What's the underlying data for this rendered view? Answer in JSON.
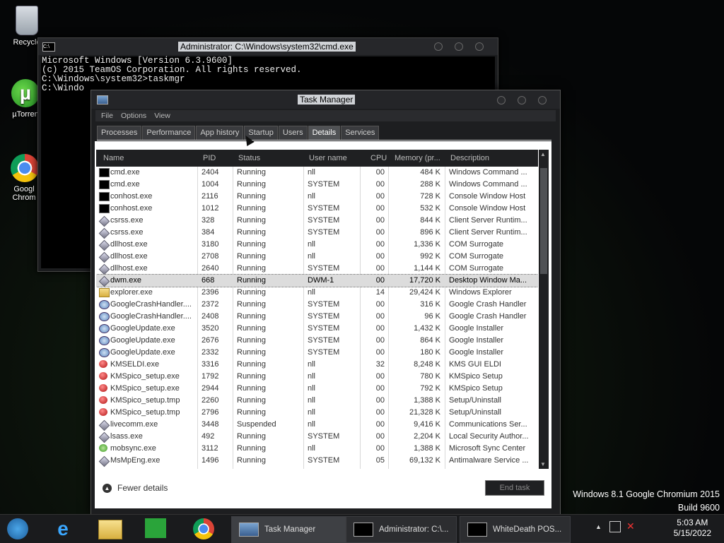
{
  "desktop": {
    "icons": [
      {
        "label": "Recycle"
      },
      {
        "label": "µTorren"
      },
      {
        "label": "Googl Chrom"
      }
    ]
  },
  "cmd_window": {
    "title": "Administrator: C:\\Windows\\system32\\cmd.exe",
    "lines": [
      "Microsoft Windows [Version 6.3.9600]",
      "(c) 2015 TeamOS Corporation. All rights reserved.",
      "",
      "C:\\Windows\\system32>taskmgr",
      "",
      "C:\\Windo"
    ]
  },
  "task_manager": {
    "title": "Task Manager",
    "menu": [
      "File",
      "Options",
      "View"
    ],
    "tabs": [
      "Processes",
      "Performance",
      "App history",
      "Startup",
      "Users",
      "Details",
      "Services"
    ],
    "active_tab": "Details",
    "columns": [
      "Name",
      "PID",
      "Status",
      "User name",
      "CPU",
      "Memory (pr...",
      "Description"
    ],
    "rows": [
      {
        "icon": "cmd",
        "name": "cmd.exe",
        "pid": "2404",
        "status": "Running",
        "user": "nll",
        "cpu": "00",
        "mem": "484 K",
        "desc": "Windows Command ..."
      },
      {
        "icon": "cmd",
        "name": "cmd.exe",
        "pid": "1004",
        "status": "Running",
        "user": "SYSTEM",
        "cpu": "00",
        "mem": "288 K",
        "desc": "Windows Command ..."
      },
      {
        "icon": "cmd",
        "name": "conhost.exe",
        "pid": "2116",
        "status": "Running",
        "user": "nll",
        "cpu": "00",
        "mem": "728 K",
        "desc": "Console Window Host"
      },
      {
        "icon": "cmd",
        "name": "conhost.exe",
        "pid": "1012",
        "status": "Running",
        "user": "SYSTEM",
        "cpu": "00",
        "mem": "532 K",
        "desc": "Console Window Host"
      },
      {
        "icon": "diamond",
        "name": "csrss.exe",
        "pid": "328",
        "status": "Running",
        "user": "SYSTEM",
        "cpu": "00",
        "mem": "844 K",
        "desc": "Client Server Runtim..."
      },
      {
        "icon": "diamond",
        "name": "csrss.exe",
        "pid": "384",
        "status": "Running",
        "user": "SYSTEM",
        "cpu": "00",
        "mem": "896 K",
        "desc": "Client Server Runtim..."
      },
      {
        "icon": "diamond",
        "name": "dllhost.exe",
        "pid": "3180",
        "status": "Running",
        "user": "nll",
        "cpu": "00",
        "mem": "1,336 K",
        "desc": "COM Surrogate"
      },
      {
        "icon": "diamond",
        "name": "dllhost.exe",
        "pid": "2708",
        "status": "Running",
        "user": "nll",
        "cpu": "00",
        "mem": "992 K",
        "desc": "COM Surrogate"
      },
      {
        "icon": "diamond",
        "name": "dllhost.exe",
        "pid": "2640",
        "status": "Running",
        "user": "SYSTEM",
        "cpu": "00",
        "mem": "1,144 K",
        "desc": "COM Surrogate"
      },
      {
        "icon": "diamond",
        "name": "dwm.exe",
        "pid": "668",
        "status": "Running",
        "user": "DWM-1",
        "cpu": "00",
        "mem": "17,720 K",
        "desc": "Desktop Window Ma...",
        "selected": true
      },
      {
        "icon": "folder",
        "name": "explorer.exe",
        "pid": "2396",
        "status": "Running",
        "user": "nll",
        "cpu": "14",
        "mem": "29,424 K",
        "desc": "Windows Explorer"
      },
      {
        "icon": "google",
        "name": "GoogleCrashHandler....",
        "pid": "2372",
        "status": "Running",
        "user": "SYSTEM",
        "cpu": "00",
        "mem": "316 K",
        "desc": "Google Crash Handler"
      },
      {
        "icon": "google",
        "name": "GoogleCrashHandler....",
        "pid": "2408",
        "status": "Running",
        "user": "SYSTEM",
        "cpu": "00",
        "mem": "96 K",
        "desc": "Google Crash Handler"
      },
      {
        "icon": "google",
        "name": "GoogleUpdate.exe",
        "pid": "3520",
        "status": "Running",
        "user": "SYSTEM",
        "cpu": "00",
        "mem": "1,432 K",
        "desc": "Google Installer"
      },
      {
        "icon": "google",
        "name": "GoogleUpdate.exe",
        "pid": "2676",
        "status": "Running",
        "user": "SYSTEM",
        "cpu": "00",
        "mem": "864 K",
        "desc": "Google Installer"
      },
      {
        "icon": "google",
        "name": "GoogleUpdate.exe",
        "pid": "2332",
        "status": "Running",
        "user": "SYSTEM",
        "cpu": "00",
        "mem": "180 K",
        "desc": "Google Installer"
      },
      {
        "icon": "kms",
        "name": "KMSELDI.exe",
        "pid": "3316",
        "status": "Running",
        "user": "nll",
        "cpu": "32",
        "mem": "8,248 K",
        "desc": "KMS GUI ELDI"
      },
      {
        "icon": "kms",
        "name": "KMSpico_setup.exe",
        "pid": "1792",
        "status": "Running",
        "user": "nll",
        "cpu": "00",
        "mem": "780 K",
        "desc": "KMSpico Setup"
      },
      {
        "icon": "kms",
        "name": "KMSpico_setup.exe",
        "pid": "2944",
        "status": "Running",
        "user": "nll",
        "cpu": "00",
        "mem": "792 K",
        "desc": "KMSpico Setup"
      },
      {
        "icon": "kms",
        "name": "KMSpico_setup.tmp",
        "pid": "2260",
        "status": "Running",
        "user": "nll",
        "cpu": "00",
        "mem": "1,388 K",
        "desc": "Setup/Uninstall"
      },
      {
        "icon": "kms",
        "name": "KMSpico_setup.tmp",
        "pid": "2796",
        "status": "Running",
        "user": "nll",
        "cpu": "00",
        "mem": "21,328 K",
        "desc": "Setup/Uninstall"
      },
      {
        "icon": "diamond",
        "name": "livecomm.exe",
        "pid": "3448",
        "status": "Suspended",
        "user": "nll",
        "cpu": "00",
        "mem": "9,416 K",
        "desc": "Communications Ser..."
      },
      {
        "icon": "diamond",
        "name": "lsass.exe",
        "pid": "492",
        "status": "Running",
        "user": "SYSTEM",
        "cpu": "00",
        "mem": "2,204 K",
        "desc": "Local Security Author..."
      },
      {
        "icon": "sync",
        "name": "mobsync.exe",
        "pid": "3112",
        "status": "Running",
        "user": "nll",
        "cpu": "00",
        "mem": "1,388 K",
        "desc": "Microsoft Sync Center"
      },
      {
        "icon": "diamond",
        "name": "MsMpEng.exe",
        "pid": "1496",
        "status": "Running",
        "user": "SYSTEM",
        "cpu": "05",
        "mem": "69,132 K",
        "desc": "Antimalware Service ..."
      }
    ],
    "fewer_details": "Fewer details",
    "end_task": "End task"
  },
  "watermark": {
    "line1": "Windows 8.1 Google Chromium 2015",
    "line2": "Build 9600"
  },
  "taskbar": {
    "items": [
      {
        "label": "Task Manager"
      },
      {
        "label": "Administrator: C:\\..."
      },
      {
        "label": "WhiteDeath POS..."
      }
    ],
    "clock": {
      "time": "5:03 AM",
      "date": "5/15/2022"
    }
  }
}
